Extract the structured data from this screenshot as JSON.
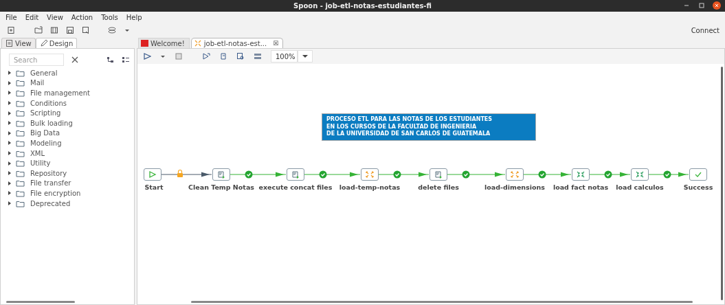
{
  "window": {
    "title": "Spoon - job-etl-notas-estudiantes-fi"
  },
  "menu": [
    "File",
    "Edit",
    "View",
    "Action",
    "Tools",
    "Help"
  ],
  "toolbar": {
    "connect": "Connect"
  },
  "left_panel": {
    "tabs": [
      {
        "label": "View",
        "selected": false
      },
      {
        "label": "Design",
        "selected": true
      }
    ],
    "search": {
      "placeholder": "Search"
    },
    "tree": [
      {
        "label": "General",
        "expanded": false
      },
      {
        "label": "Mail",
        "expanded": false
      },
      {
        "label": "File management",
        "expanded": false
      },
      {
        "label": "Conditions",
        "expanded": false
      },
      {
        "label": "Scripting",
        "expanded": false
      },
      {
        "label": "Bulk loading",
        "expanded": false
      },
      {
        "label": "Big Data",
        "expanded": false
      },
      {
        "label": "Modeling",
        "expanded": false
      },
      {
        "label": "XML",
        "expanded": false
      },
      {
        "label": "Utility",
        "expanded": false
      },
      {
        "label": "Repository",
        "expanded": false
      },
      {
        "label": "File transfer",
        "expanded": false
      },
      {
        "label": "File encryption",
        "expanded": false
      },
      {
        "label": "Deprecated",
        "expanded": false
      }
    ]
  },
  "editor_tabs": [
    {
      "label": "Welcome!",
      "kind": "welcome",
      "selected": false
    },
    {
      "label": "job-etl-notas-est...",
      "kind": "job",
      "selected": true,
      "close": "☒"
    }
  ],
  "canvas_toolbar": {
    "zoom": "100%"
  },
  "note": {
    "lines": [
      "PROCESO ETL PARA LAS NOTAS DE LOS ESTUDIANTES",
      "EN LOS CURSOS DE LA FACULTAD DE INGENIERIA",
      "DE LA UNIVERSIDAD DE SAN CARLOS DE GUATEMALA"
    ]
  },
  "nodes": [
    {
      "label": "Start",
      "kind": "start"
    },
    {
      "label": "Clean Temp Notas",
      "kind": "shell"
    },
    {
      "label": "execute concat files",
      "kind": "shell"
    },
    {
      "label": "load-temp-notas",
      "kind": "transformation"
    },
    {
      "label": "delete files",
      "kind": "shell"
    },
    {
      "label": "load-dimensions",
      "kind": "transformation"
    },
    {
      "label": "load fact notas",
      "kind": "job"
    },
    {
      "label": "load calculos",
      "kind": "job"
    },
    {
      "label": "Success",
      "kind": "success"
    }
  ],
  "hops": [
    {
      "kind": "unconditional"
    },
    {
      "kind": "success"
    },
    {
      "kind": "success"
    },
    {
      "kind": "success"
    },
    {
      "kind": "success"
    },
    {
      "kind": "success"
    },
    {
      "kind": "success"
    },
    {
      "kind": "success"
    }
  ]
}
